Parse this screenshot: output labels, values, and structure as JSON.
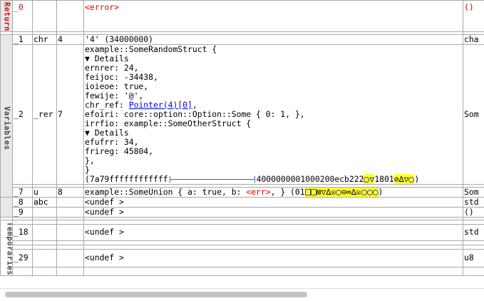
{
  "sections": {
    "return_label": "Return",
    "variables_label": "Variables",
    "temporaries_label": "Temporaries"
  },
  "rows": {
    "r0": {
      "name": "_0",
      "type": "",
      "size": "",
      "value": "<error>",
      "ty": "()"
    },
    "r1": {
      "name": "_1",
      "type": "chr",
      "size": "4",
      "value": "'4' (34000000)",
      "ty": "cha"
    },
    "r2": {
      "name": "_2",
      "type": "_rer",
      "size": "7",
      "ty": "Som",
      "lines": [
        "example::SomeRandomStruct {",
        "▼ Details",
        "ernrer: 24,",
        "feijoc: -34438,",
        "ioieoe: true,",
        "fewije: '@',"
      ],
      "chr_ref_label": "chr_ref: ",
      "chr_ref_link": "Pointer(4)[0]",
      "chr_ref_tail": ",",
      "lines2": [
        "efoiri: core::option::Option::Some { 0: 1, },",
        "irrfio: example::SomeOtherStruct {",
        "▼ Details",
        "efufrr: 34,",
        "frireg: 45804,",
        "},",
        "}"
      ],
      "bytes_prefix": "(7a79ffffffffffff",
      "bytes_middle": "4000000001000200ecb222",
      "bytes_mid2": "1801",
      "bytes_suffix": ")"
    },
    "r7": {
      "name": "_7",
      "type": "u",
      "size": "8",
      "value_pre": "example::SomeUnion { a: true, b: ",
      "value_err": "<err>",
      "value_post": ", } (01",
      "value_end": ")",
      "ty": "Som"
    },
    "r8": {
      "name": "_8",
      "type": "abc",
      "size": "",
      "value": "<undef >",
      "ty": "std"
    },
    "r9": {
      "name": "_9",
      "type": "",
      "size": "",
      "value": "<undef >",
      "ty": "()"
    },
    "r18": {
      "name": "_18",
      "type": "",
      "size": "",
      "value": "<undef >",
      "ty": "std"
    },
    "r29": {
      "name": "_29",
      "type": "",
      "size": "",
      "value": "<undef >",
      "ty": "u8"
    }
  },
  "colors": {
    "error": "#e00000",
    "link": "#0000ee",
    "highlight": "#ffff33"
  }
}
